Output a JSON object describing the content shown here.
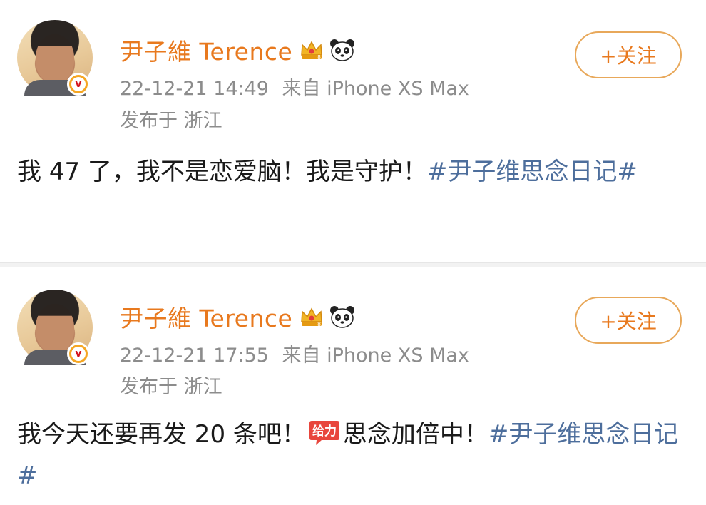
{
  "posts": [
    {
      "username": "尹子維 Terence",
      "time": "22-12-21 14:49",
      "device": "来自 iPhone XS Max",
      "location": "发布于 浙江",
      "follow_label": "+关注",
      "text_before": "我 47 了，我不是恋爱脑！我是守护！",
      "text_after": "",
      "emoji_text": "",
      "hashtag": "#尹子维思念日记#"
    },
    {
      "username": "尹子維 Terence",
      "time": "22-12-21 17:55",
      "device": "来自 iPhone XS Max",
      "location": "发布于 浙江",
      "follow_label": "+关注",
      "text_before": "我今天还要再发 20 条吧！",
      "emoji_text": "给力",
      "text_after": "思念加倍中！",
      "hashtag": "#尹子维思念日记#"
    }
  ],
  "colors": {
    "username": "#e8791e",
    "hashtag": "#4d6e9c",
    "meta": "#8c8c8c",
    "follow_border": "#e8a85a"
  },
  "icons": {
    "crown": "crown-badge-icon",
    "panda": "panda-icon",
    "verified": "verified-v-icon",
    "emoji": "geili-emoji-icon"
  }
}
